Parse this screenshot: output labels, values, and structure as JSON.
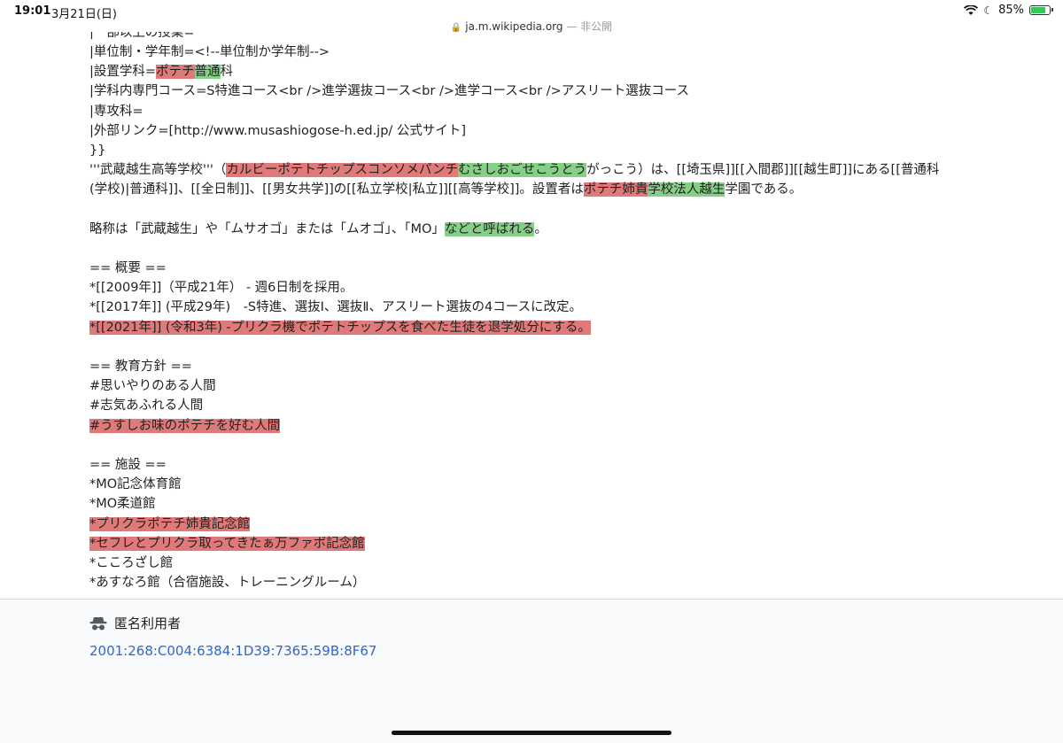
{
  "status_bar": {
    "time": "19:01",
    "date": "3月21日(日)",
    "battery_percent_label": "85%",
    "battery_level": 0.85
  },
  "url_bar": {
    "domain": "ja.m.wikipedia.org",
    "suffix": " — 非公開"
  },
  "wikitext": {
    "l0": "|一部以上の授業=",
    "l1": "|単位制・学年制=<!--単位制か学年制-->",
    "l2a": "|設置学科=",
    "l2b": "ポテチ",
    "l2c": "普通",
    "l2d": "科",
    "l3": "|学科内専門コース=S特進コース<br />進学選抜コース<br />進学コース<br />アスリート選抜コース",
    "l4": "|専攻科=",
    "l5": "|外部リンク=[http://www.musashiogose-h.ed.jp/ 公式サイト]",
    "l6": "}}",
    "l7a": "'''武蔵越生高等学校'''（",
    "l7b": "カルビーポテトチップスコンソメパンチ",
    "l7c": "むさしおごせこうとう",
    "l7d": "がっこう）は、[[埼玉県]][[入間郡]][[越生町]]にある[[普通科",
    "l8a": "(学校)|普通科]]、[[全日制]]、[[男女共学]]の[[私立学校|私立]][[高等学校]]。設置者は",
    "l8b": "ポテチ姉貴",
    "l8c": "学校法人越生",
    "l8d": "学園である。",
    "l9a": "略称は「武蔵越生」や「ムサオゴ」または「ムオゴ」、「MO」",
    "l9b": "などと呼ばれる",
    "l9c": "。",
    "l10": "== 概要 ==",
    "l11": "*[[2009年]]（平成21年） - 週6日制を採用。",
    "l12": "*[[2017年]] (平成29年)　-S特進、選抜Ⅰ、選抜Ⅱ、アスリート選抜の4コースに改定。",
    "l13": "*[[2021年]] (令和3年) -プリクラ機でポテトチップスを食べた生徒を退学処分にする。",
    "l14": "== 教育方針 ==",
    "l15": "#思いやりのある人間",
    "l16": "#志気あふれる人間",
    "l17": "#うすしお味のポテチを好む人間",
    "l18": "== 施設 ==",
    "l19": "*MO記念体育館",
    "l20": "*MO柔道館",
    "l21": "*プリクラポテチ姉貴記念館",
    "l22": "*セフレとプリクラ取ってきたぁ万ファボ記念館",
    "l23": "*こころざし館",
    "l24": "*あすなろ館（合宿施設、トレーニングルーム）"
  },
  "footer": {
    "user_label": "匿名利用者",
    "ip": "2001:268:C004:6384:1D39:7365:59B:8F67"
  },
  "colors": {
    "deleted_highlight": "#e07a7a",
    "added_highlight": "#86cf86",
    "link": "#3366cc"
  }
}
